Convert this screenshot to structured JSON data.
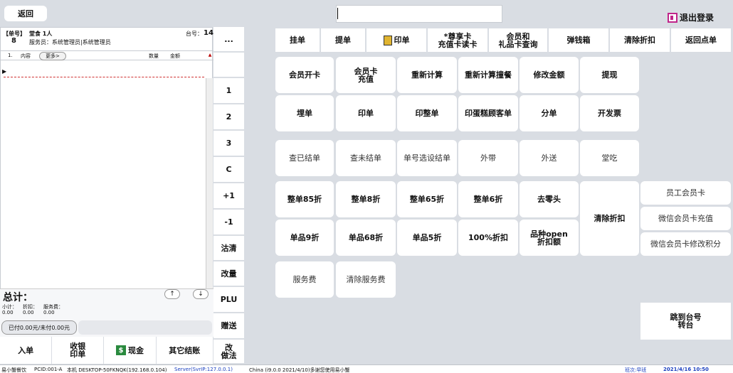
{
  "header": {
    "back_label": "返回",
    "search_value": "",
    "logout_label": "退出登录"
  },
  "order": {
    "order_no_label": "【单号】",
    "order_no": "8",
    "dine_type": "堂食 1人",
    "staff": "服务员：系统管理员|系统管理员",
    "table_label": "台号：",
    "table_no": "14",
    "columns": {
      "no": "1.",
      "content": "内容",
      "more": "更多>",
      "qty": "数量",
      "amount": "金额"
    },
    "total_label": "总计：",
    "subtotal": {
      "subtotal_label": "小计：",
      "subtotal_value": "0.00",
      "discount_label": "折扣：",
      "discount_value": "0.00",
      "service_label": "服务费：",
      "service_value": "0.00"
    },
    "paid_label": "已付0.00元/未付0.00元",
    "up_arrow": "↑",
    "down_arrow": "↓"
  },
  "order_actions": {
    "enter": "入单",
    "checkout": "收银\n印单",
    "cash": "现金",
    "other": "其它结账"
  },
  "numpad": [
    "...",
    "",
    "1",
    "2",
    "3",
    "C",
    "+1",
    "-1",
    "沽清",
    "改量",
    "PLU",
    "赠送",
    "改\n做法"
  ],
  "function_row": [
    "挂单",
    "提单",
    "印单",
    "*尊享卡\n充值卡读卡",
    "会员和\n礼品卡查询",
    "弹钱箱",
    "清除折扣",
    "返回点单"
  ],
  "grid": {
    "row1": [
      "会员开卡",
      "会员卡\n充值",
      "重新计算",
      "重新计算撞餐",
      "修改金额",
      "提现"
    ],
    "row2": [
      "埋单",
      "印单",
      "印整单",
      "印蛋糕顾客单",
      "分单",
      "开发票"
    ],
    "row3": [
      "查已结单",
      "查未结单",
      "单号选设结单",
      "外带",
      "外送",
      "堂吃"
    ],
    "row4": [
      "整单85折",
      "整单8折",
      "整单65折",
      "整单6折",
      "去零头"
    ],
    "row5": [
      "单品9折",
      "单品68折",
      "单品5折",
      "100%折扣",
      "品种open\n折扣额"
    ],
    "clear_discount": "清除折扣",
    "row6": [
      "服务费",
      "清除服务费"
    ],
    "member_side": [
      "员工会员卡",
      "微信会员卡充值",
      "微信会员卡修改积分"
    ],
    "goto_table": "跳到台号\n转台"
  },
  "statusbar": {
    "app": "易小蟹餐饮",
    "pcid": "PCID:001-A",
    "machine": "本机 DESKTOP-50FKNQK(192.168.0.104)",
    "server": "Server(SvrIP:127.0.0.1)",
    "version": "China (i9.0.0 2021/4/10)多谢您使用易小蟹",
    "shift": "班次:早班",
    "datetime": "2021/4/16 10:50"
  },
  "colors": {
    "background": "#d9dde3",
    "button": "#ffffff",
    "accent_magenta": "#c0258a",
    "cash_green": "#2a8a3e",
    "row_red": "#d03030",
    "status_blue": "#1a3fbf"
  }
}
